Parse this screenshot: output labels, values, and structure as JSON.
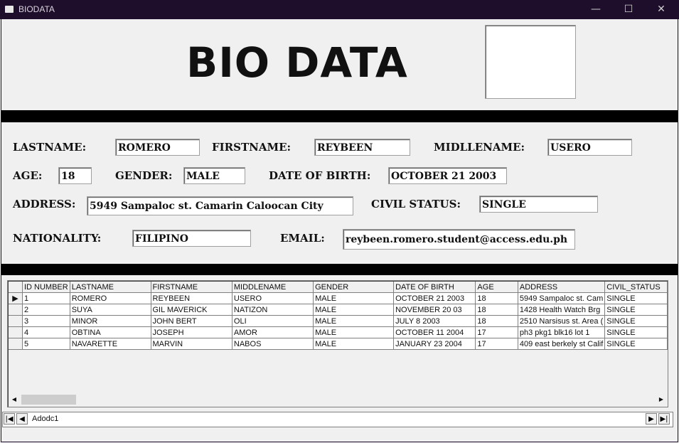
{
  "window": {
    "title": "BIODATA",
    "controls": {
      "minimize": "—",
      "maximize": "☐",
      "close": "✕"
    }
  },
  "heading": "BIO DATA",
  "form": {
    "lastname": {
      "label": "LASTNAME:",
      "value": "ROMERO"
    },
    "firstname": {
      "label": "FIRSTNAME:",
      "value": "REYBEEN"
    },
    "middlename": {
      "label": "MIDLLENAME:",
      "value": "USERO"
    },
    "age": {
      "label": "AGE:",
      "value": "18"
    },
    "gender": {
      "label": "GENDER:",
      "value": "MALE"
    },
    "dob": {
      "label": "DATE OF BIRTH:",
      "value": "OCTOBER 21 2003"
    },
    "address": {
      "label": "ADDRESS:",
      "value": "5949 Sampaloc st. Camarin Caloocan City"
    },
    "civil_status": {
      "label": "CIVIL STATUS:",
      "value": "SINGLE"
    },
    "nationality": {
      "label": "NATIONALITY:",
      "value": "FILIPINO"
    },
    "email": {
      "label": "EMAIL:",
      "value": "reybeen.romero.student@access.edu.ph"
    }
  },
  "grid": {
    "columns": [
      "ID NUMBER",
      "LASTNAME",
      "FIRSTNAME",
      "MIDDLENAME",
      "GENDER",
      "DATE OF BIRTH",
      "AGE",
      "ADDRESS",
      "CIVIL_STATUS"
    ],
    "rows": [
      [
        "1",
        "ROMERO",
        "REYBEEN",
        "USERO",
        "MALE",
        "OCTOBER 21 2003",
        "18",
        "5949 Sampaloc st. Cam",
        "SINGLE"
      ],
      [
        "2",
        "SUYA",
        "GIL MAVERICK",
        "NATIZON",
        "MALE",
        "NOVEMBER 20 03",
        "18",
        "1428 Health Watch Brg",
        "SINGLE"
      ],
      [
        "3",
        "MINOR",
        "JOHN BERT",
        "OLI",
        "MALE",
        "JULY 8 2003",
        "18",
        "2510 Narsisus st. Area (",
        "SINGLE"
      ],
      [
        "4",
        "OBTINA",
        "JOSEPH",
        "AMOR",
        "MALE",
        "OCTOBER 11 2004",
        "17",
        "ph3 pkg1 blk16 lot 1",
        "SINGLE"
      ],
      [
        "5",
        "NAVARETTE",
        "MARVIN",
        "NABOS",
        "MALE",
        "JANUARY 23 2004",
        "17",
        "409 east berkely st Calif",
        "SINGLE"
      ]
    ],
    "selected_row_marker": "▶"
  },
  "data_control": {
    "caption": "Adodc1",
    "first": "|◀",
    "prev": "◀",
    "next": "▶",
    "last": "▶|"
  }
}
